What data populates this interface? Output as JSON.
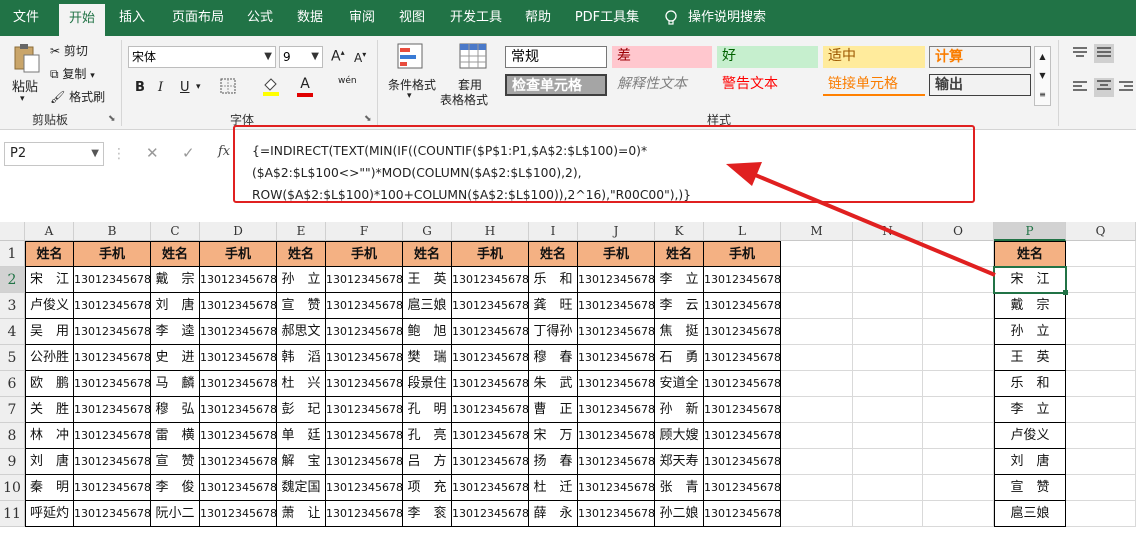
{
  "menu": {
    "tabs": [
      "文件",
      "开始",
      "插入",
      "页面布局",
      "公式",
      "数据",
      "审阅",
      "视图",
      "开发工具",
      "帮助",
      "PDF工具集",
      "操作说明搜索"
    ]
  },
  "ribbon": {
    "paste": "粘贴",
    "cut": "剪切",
    "copy": "复制",
    "format_painter": "格式刷",
    "clipboard_label": "剪贴板",
    "font_name": "宋体",
    "font_size": "9",
    "font_label": "字体",
    "grow_font": "A",
    "shrink_font": "A",
    "bold": "B",
    "italic": "I",
    "underline": "U",
    "font_color_glyph": "A",
    "phonetic_glyph": "wén",
    "cond_format": "条件格式",
    "table_format_1": "套用",
    "table_format_2": "表格格式",
    "styles_label": "样式",
    "styles": [
      "常规",
      "差",
      "好",
      "适中",
      "计算",
      "检查单元格",
      "解释性文本",
      "警告文本",
      "链接单元格",
      "输出"
    ]
  },
  "formula_bar": {
    "name_box": "P2",
    "fx": "fx",
    "line1": "{=INDIRECT(TEXT(MIN(IF((COUNTIF($P$1:P1,$A$2:$L$100)=0)*($A$2:$L$100<>\"\")*MOD(COLUMN($A$2:$L$100),2),",
    "line2": "ROW($A$2:$L$100)*100+COLUMN($A$2:$L$100)),2^16),\"R00C00\"),)}"
  },
  "sheet": {
    "columns": [
      "A",
      "B",
      "C",
      "D",
      "E",
      "F",
      "G",
      "H",
      "I",
      "J",
      "K",
      "L",
      "M",
      "N",
      "O",
      "P",
      "Q"
    ],
    "rows": [
      "1",
      "2",
      "3",
      "4",
      "5",
      "6",
      "7",
      "8",
      "9",
      "10",
      "11"
    ],
    "header_name": "姓名",
    "header_phone": "手机",
    "phone": "13012345678",
    "names": [
      [
        "宋　江",
        "戴　宗",
        "孙　立",
        "王　英",
        "乐　和",
        "李　立"
      ],
      [
        "卢俊义",
        "刘　唐",
        "宣　赞",
        "扈三娘",
        "龚　旺",
        "李　云"
      ],
      [
        "吴　用",
        "李　逵",
        "郝思文",
        "鲍　旭",
        "丁得孙",
        "焦　挺"
      ],
      [
        "公孙胜",
        "史　进",
        "韩　滔",
        "樊　瑞",
        "穆　春",
        "石　勇"
      ],
      [
        "欧　鹏",
        "马　麟",
        "杜　兴",
        "段景住",
        "朱　武",
        "安道全"
      ],
      [
        "关　胜",
        "穆　弘",
        "彭　玘",
        "孔　明",
        "曹　正",
        "孙　新"
      ],
      [
        "林　冲",
        "雷　横",
        "单　廷",
        "孔　亮",
        "宋　万",
        "顾大嫂"
      ],
      [
        "刘　唐",
        "宣　赞",
        "解　宝",
        "吕　方",
        "扬　春",
        "郑天寿"
      ],
      [
        "秦　明",
        "李　俊",
        "魏定国",
        "项　充",
        "杜　迁",
        "张　青"
      ],
      [
        "呼延灼",
        "阮小二",
        "萧　让",
        "李　衮",
        "薛　永",
        "孙二娘"
      ]
    ],
    "p_header": "姓名",
    "p_values": [
      "宋　江",
      "戴　宗",
      "孙　立",
      "王　英",
      "乐　和",
      "李　立",
      "卢俊义",
      "刘　唐",
      "宣　赞",
      "扈三娘"
    ]
  },
  "colors": {
    "accent": "#217346",
    "header_fill": "#f4b183",
    "annotation": "#e02020"
  }
}
